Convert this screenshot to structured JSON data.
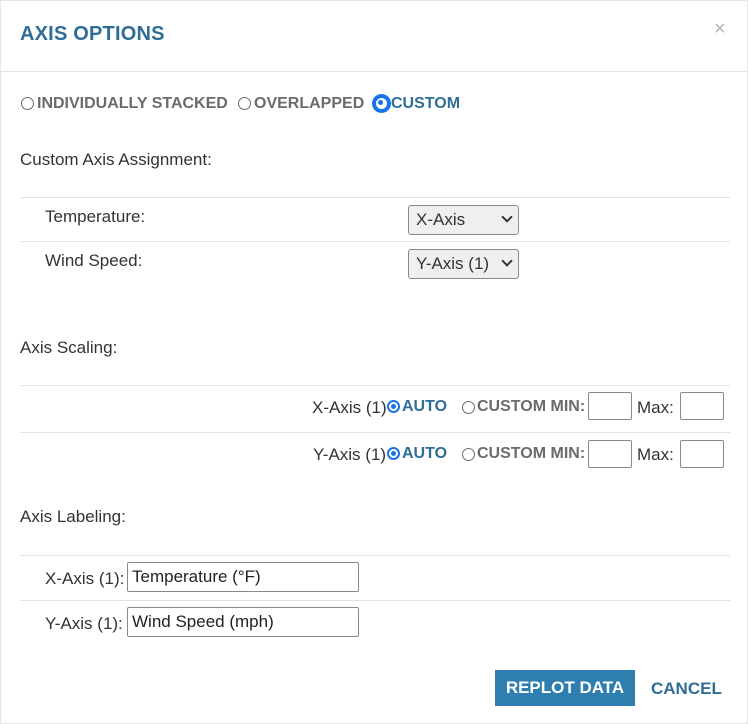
{
  "dialog": {
    "title": "AXIS OPTIONS",
    "close_glyph": "×",
    "close_icon": "close-icon"
  },
  "layout_mode": {
    "options": [
      "INDIVIDUALLY STACKED",
      "OVERLAPPED",
      "CUSTOM"
    ],
    "selected": "CUSTOM"
  },
  "assignment": {
    "heading": "Custom Axis Assignment:",
    "rows": [
      {
        "label": "Temperature:",
        "value": "X-Axis"
      },
      {
        "label": "Wind Speed:",
        "value": "Y-Axis (1)"
      }
    ]
  },
  "scaling": {
    "heading": "Axis Scaling:",
    "rows": [
      {
        "axis": "X-Axis (1)",
        "auto_label": "AUTO",
        "custom_label": "CUSTOM MIN:",
        "max_label": "Max:",
        "mode": "AUTO",
        "min": "",
        "max": ""
      },
      {
        "axis": "Y-Axis (1)",
        "auto_label": "AUTO",
        "custom_label": "CUSTOM MIN:",
        "max_label": "Max:",
        "mode": "AUTO",
        "min": "",
        "max": ""
      }
    ]
  },
  "labeling": {
    "heading": "Axis Labeling:",
    "rows": [
      {
        "label": "X-Axis (1):",
        "value": "Temperature (°F)"
      },
      {
        "label": "Y-Axis (1):",
        "value": "Wind Speed (mph)"
      }
    ]
  },
  "actions": {
    "replot": "REPLOT DATA",
    "cancel": "CANCEL"
  },
  "colors": {
    "accent": "#2f6d97",
    "primary_button": "#2e7fb0",
    "radio_selected": "#1a73e8"
  }
}
